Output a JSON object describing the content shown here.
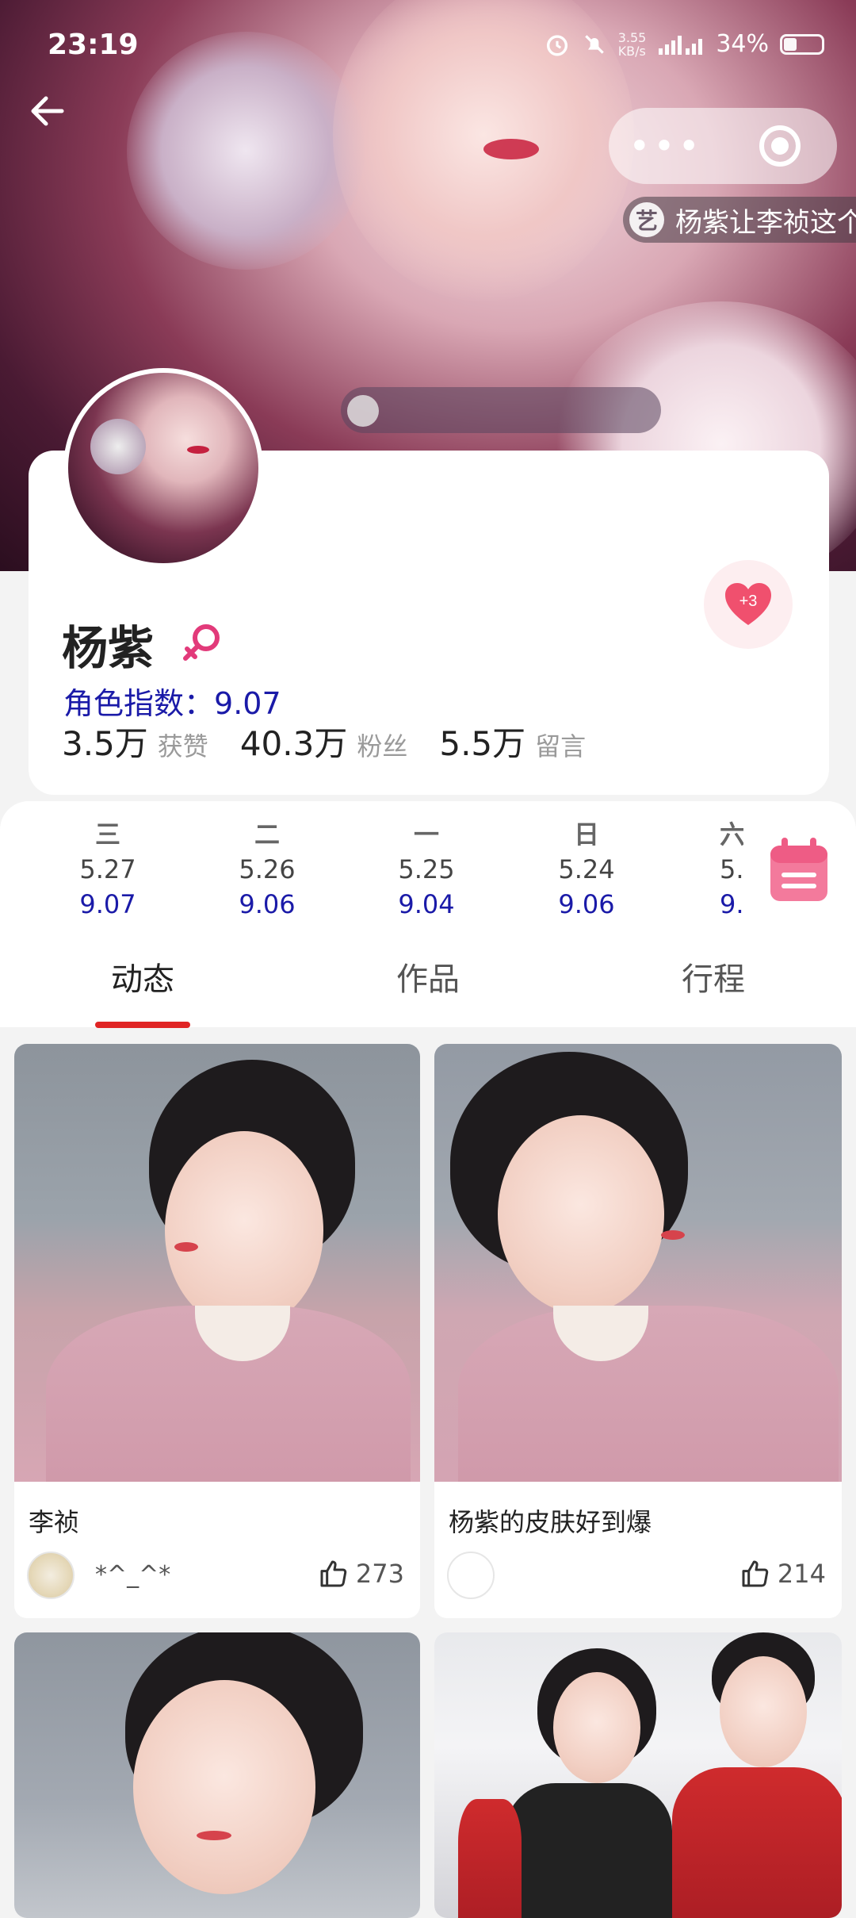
{
  "status_bar": {
    "time": "23:19",
    "net_speed": "3.55\nKB/s",
    "battery": "34%"
  },
  "header": {
    "marquee_badge": "艺",
    "marquee_text": "杨紫让李祯这个"
  },
  "profile": {
    "name": "杨紫",
    "gender_icon": "female-icon",
    "role_index_label": "角色指数：",
    "role_index_value": "9.07",
    "like_badge": "+3",
    "stats": [
      {
        "value": "3.5万",
        "unit": "获赞"
      },
      {
        "value": "40.3万",
        "unit": "粉丝"
      },
      {
        "value": "5.5万",
        "unit": "留言"
      }
    ]
  },
  "week": [
    {
      "weekday": "三",
      "date": "5.27",
      "score": "9.07"
    },
    {
      "weekday": "二",
      "date": "5.26",
      "score": "9.06"
    },
    {
      "weekday": "一",
      "date": "5.25",
      "score": "9.04"
    },
    {
      "weekday": "日",
      "date": "5.24",
      "score": "9.06"
    },
    {
      "weekday": "六",
      "date": "5.",
      "score": "9."
    }
  ],
  "tabs": [
    {
      "label": "动态",
      "active": true
    },
    {
      "label": "作品",
      "active": false
    },
    {
      "label": "行程",
      "active": false
    }
  ],
  "posts": [
    {
      "title": "李祯",
      "author": "*^_^*",
      "likes": "273"
    },
    {
      "title": "杨紫的皮肤好到爆",
      "author": "",
      "likes": "214"
    }
  ],
  "colors": {
    "accent_red": "#e02424",
    "index_blue": "#1a1aa8",
    "heart_pink": "#f0506e"
  }
}
